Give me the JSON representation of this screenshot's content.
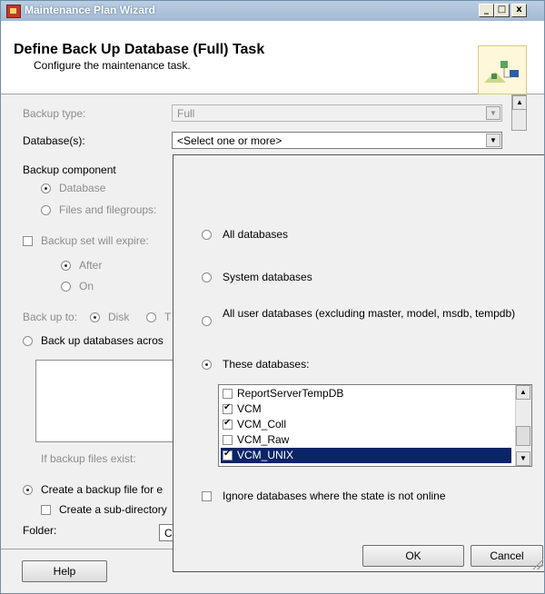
{
  "window": {
    "title": "Maintenance Plan Wizard",
    "controls": {
      "minimize": "_",
      "maximize": "□",
      "close": "x"
    }
  },
  "header": {
    "title": "Define Back Up Database (Full) Task",
    "subtitle": "Configure the maintenance task."
  },
  "form": {
    "backup_type_label": "Backup type:",
    "backup_type_value": "Full",
    "databases_label": "Database(s):",
    "databases_value": "<Select one or more>",
    "backup_component_label": "Backup component",
    "component_database": "Database",
    "component_files": "Files and filegroups:",
    "expire_label": "Backup set will expire:",
    "after_label": "After",
    "on_label": "On",
    "backup_to_label": "Back up to:",
    "disk_label": "Disk",
    "tape_label": "T",
    "across_label": "Back up databases acros",
    "if_exist_label": "If backup files exist:",
    "create_file_label": "Create a backup file for e",
    "subdir_label": "Create a sub-directory",
    "folder_label": "Folder:",
    "folder_value": "C",
    "help_button": "Help"
  },
  "popup": {
    "all_databases": "All databases",
    "system_databases": "System databases",
    "all_user_databases": "All user databases  (excluding master, model, msdb, tempdb)",
    "these_databases": "These databases:",
    "databases": [
      {
        "name": "ReportServerTempDB",
        "checked": false
      },
      {
        "name": "VCM",
        "checked": true
      },
      {
        "name": "VCM_Coll",
        "checked": true
      },
      {
        "name": "VCM_Raw",
        "checked": false
      },
      {
        "name": "VCM_UNIX",
        "checked": true
      }
    ],
    "ignore_offline": "Ignore databases where the state is not online",
    "ok_button": "OK",
    "cancel_button": "Cancel"
  },
  "colors": {
    "title_bar": "#a4bad3",
    "selection": "#0a246a"
  }
}
